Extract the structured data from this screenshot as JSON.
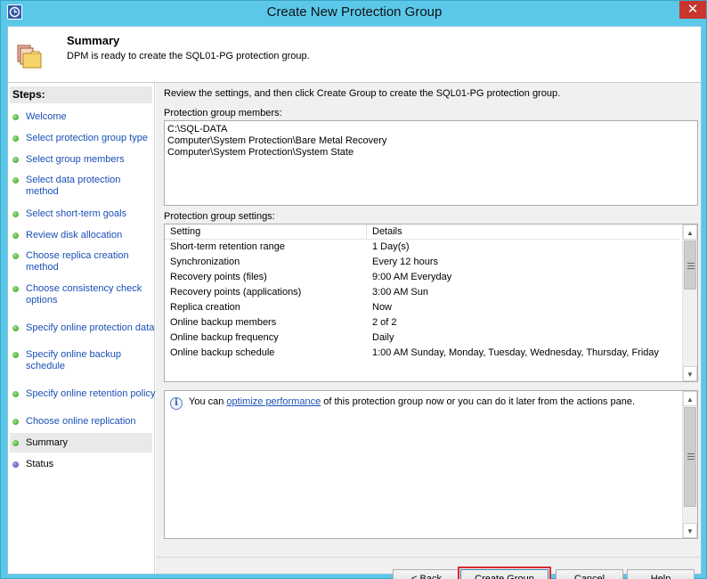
{
  "window": {
    "title": "Create New Protection Group",
    "close_glyph": "✕"
  },
  "header": {
    "title": "Summary",
    "subtitle": "DPM is ready to create the SQL01-PG protection group."
  },
  "steps": {
    "heading": "Steps:",
    "items": [
      {
        "label": "Welcome",
        "state": "done"
      },
      {
        "label": "Select protection group type",
        "state": "done"
      },
      {
        "label": "Select group members",
        "state": "done"
      },
      {
        "label": "Select data protection method",
        "state": "done"
      },
      {
        "label": "Select short-term goals",
        "state": "done"
      },
      {
        "label": "Review disk allocation",
        "state": "done"
      },
      {
        "label": "Choose replica creation method",
        "state": "done"
      },
      {
        "label": "Choose consistency check options",
        "state": "done"
      },
      {
        "label": "Specify online protection data",
        "state": "done"
      },
      {
        "label": "Specify online backup schedule",
        "state": "done"
      },
      {
        "label": "Specify online retention policy",
        "state": "done"
      },
      {
        "label": "Choose online replication",
        "state": "done"
      },
      {
        "label": "Summary",
        "state": "current"
      },
      {
        "label": "Status",
        "state": "pending"
      }
    ]
  },
  "main": {
    "intro": "Review the settings, and then click Create Group to create the SQL01-PG protection group.",
    "members_label": "Protection group members:",
    "members": [
      "C:\\SQL-DATA",
      "Computer\\System Protection\\Bare Metal Recovery",
      "Computer\\System Protection\\System State"
    ],
    "settings_label": "Protection group settings:",
    "settings_columns": [
      "Setting",
      "Details"
    ],
    "settings_rows": [
      [
        "Short-term retention range",
        "1 Day(s)"
      ],
      [
        "Synchronization",
        "Every 12 hours"
      ],
      [
        "Recovery points (files)",
        "9:00 AM Everyday"
      ],
      [
        "Recovery points (applications)",
        "3:00 AM Sun"
      ],
      [
        "Replica creation",
        "Now"
      ],
      [
        "Online backup members",
        "2 of 2"
      ],
      [
        "Online backup frequency",
        "Daily"
      ],
      [
        "Online backup schedule",
        "1:00 AM Sunday, Monday, Tuesday, Wednesday, Thursday, Friday"
      ]
    ],
    "info": {
      "before": "You can ",
      "link": "optimize performance",
      "after": " of this protection group now or you can do it later from the actions pane."
    }
  },
  "buttons": {
    "back": "< Back",
    "create": "Create Group",
    "cancel": "Cancel",
    "help": "Help"
  }
}
